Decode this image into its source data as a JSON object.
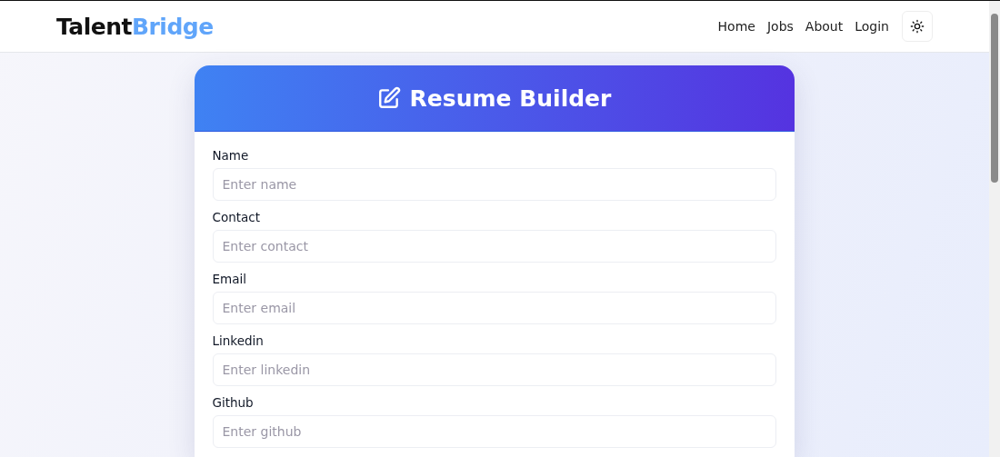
{
  "brand": {
    "part_1": "Talent",
    "part_2": "Bridge"
  },
  "nav": {
    "links": [
      "Home",
      "Jobs",
      "About",
      "Login"
    ]
  },
  "card": {
    "title": "Resume Builder",
    "fields": [
      {
        "label": "Name",
        "placeholder": "Enter name"
      },
      {
        "label": "Contact",
        "placeholder": "Enter contact"
      },
      {
        "label": "Email",
        "placeholder": "Enter email"
      },
      {
        "label": "Linkedin",
        "placeholder": "Enter linkedin"
      },
      {
        "label": "Github",
        "placeholder": "Enter github"
      }
    ]
  }
}
